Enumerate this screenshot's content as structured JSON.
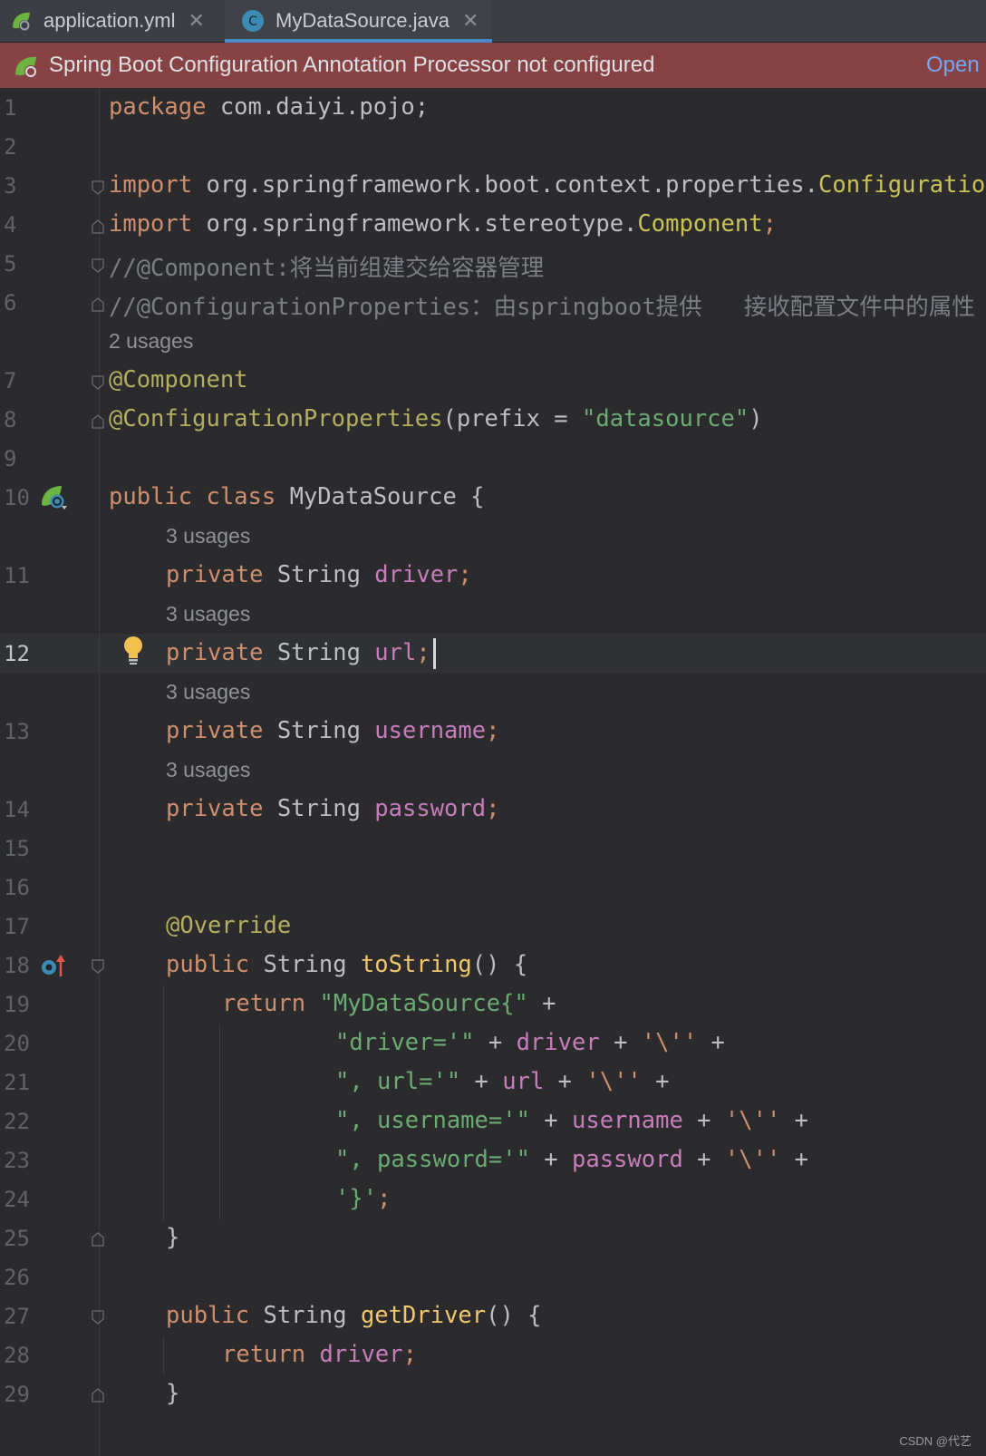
{
  "tabs": [
    {
      "label": "application.yml",
      "icon": "spring-yaml-icon",
      "active": false
    },
    {
      "label": "MyDataSource.java",
      "icon": "class-c-icon",
      "active": true
    }
  ],
  "banner": {
    "text": "Spring Boot Configuration Annotation Processor not configured",
    "link": "Open"
  },
  "current_line": "12",
  "lines": {
    "l1": {
      "num": "1",
      "t": [
        "package",
        " com.daiyi.pojo;"
      ]
    },
    "l2": {
      "num": "2"
    },
    "l3": {
      "num": "3",
      "t": [
        "import",
        " org.springframework.boot.context.properties.",
        "ConfigurationProperties"
      ]
    },
    "l4": {
      "num": "4",
      "t": [
        "import",
        " org.springframework.stereotype.",
        "Component",
        ";"
      ]
    },
    "l5": {
      "num": "5",
      "t": [
        "//@Component:将当前组建交给容器管理"
      ]
    },
    "l6": {
      "num": "6",
      "t": [
        "//@ConfigurationProperties：由springboot提供   接收配置文件中的属性"
      ]
    },
    "u1": {
      "t": "2 usages"
    },
    "l7": {
      "num": "7",
      "t": [
        "@Component"
      ]
    },
    "l8": {
      "num": "8",
      "t": [
        "@ConfigurationProperties",
        "(prefix = ",
        "\"datasource\"",
        ")"
      ]
    },
    "l9": {
      "num": "9"
    },
    "l10": {
      "num": "10",
      "t": [
        "public class",
        " MyDataSource {"
      ]
    },
    "u2": {
      "t": "3 usages"
    },
    "l11": {
      "num": "11",
      "t": [
        "private",
        " String ",
        "driver",
        ";"
      ]
    },
    "u3": {
      "t": "3 usages"
    },
    "l12": {
      "num": "12",
      "t": [
        "private",
        " String ",
        "url",
        ";"
      ]
    },
    "u4": {
      "t": "3 usages"
    },
    "l13": {
      "num": "13",
      "t": [
        "private",
        " String ",
        "username",
        ";"
      ]
    },
    "u5": {
      "t": "3 usages"
    },
    "l14": {
      "num": "14",
      "t": [
        "private",
        " String ",
        "password",
        ";"
      ]
    },
    "l15": {
      "num": "15"
    },
    "l16": {
      "num": "16"
    },
    "l17": {
      "num": "17",
      "t": [
        "@Override"
      ]
    },
    "l18": {
      "num": "18",
      "t": [
        "public",
        " String ",
        "toString",
        "() {"
      ]
    },
    "l19": {
      "num": "19",
      "t": [
        "return",
        " ",
        "\"MyDataSource{\"",
        " +"
      ]
    },
    "l20": {
      "num": "20",
      "t": [
        "\"driver='\"",
        " + ",
        "driver",
        " + ",
        "'\\''",
        " +"
      ]
    },
    "l21": {
      "num": "21",
      "t": [
        "\", url='\"",
        " + ",
        "url",
        " + ",
        "'\\''",
        " +"
      ]
    },
    "l22": {
      "num": "22",
      "t": [
        "\", username='\"",
        " + ",
        "username",
        " + ",
        "'\\''",
        " +"
      ]
    },
    "l23": {
      "num": "23",
      "t": [
        "\", password='\"",
        " + ",
        "password",
        " + ",
        "'\\''",
        " +"
      ]
    },
    "l24": {
      "num": "24",
      "t": [
        "'}'",
        ";"
      ]
    },
    "l25": {
      "num": "25",
      "t": [
        "}"
      ]
    },
    "l26": {
      "num": "26"
    },
    "l27": {
      "num": "27",
      "t": [
        "public",
        " String ",
        "getDriver",
        "() {"
      ]
    },
    "l28": {
      "num": "28",
      "t": [
        "return",
        " ",
        "driver",
        ";"
      ]
    },
    "l29": {
      "num": "29",
      "t": [
        "}"
      ]
    }
  },
  "watermark": "CSDN @代艺",
  "colors": {
    "keyword": "#cf8e6d",
    "annotation": "#b3ae60",
    "string": "#6aab73",
    "field": "#c77dbb",
    "comment": "#7a7e85",
    "method": "#f0c66e",
    "banner_bg": "#874343",
    "tab_underline": "#4a88c7"
  }
}
